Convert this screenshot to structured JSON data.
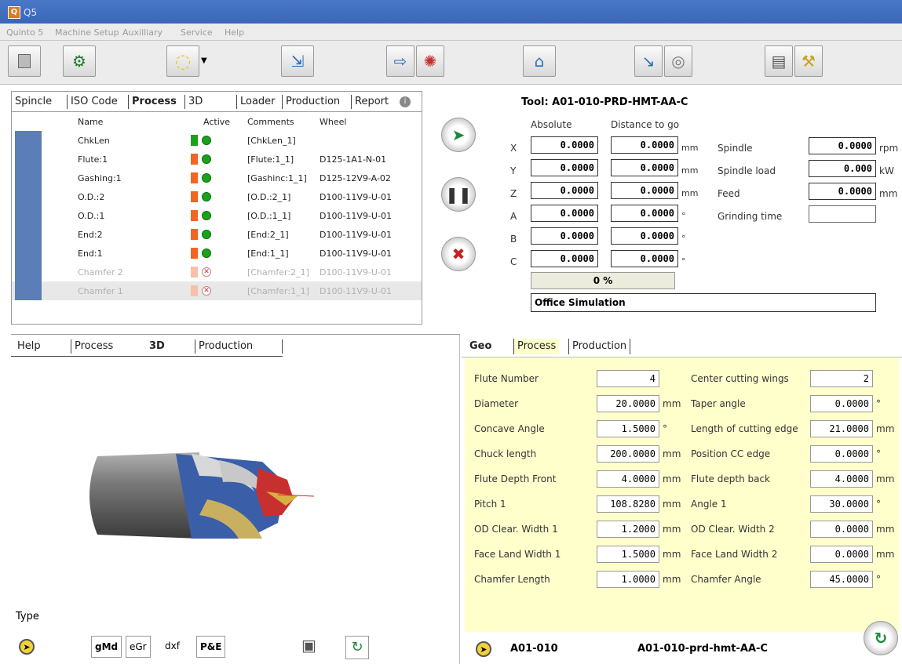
{
  "window": {
    "title": "Q5"
  },
  "menu": [
    "Quinto 5",
    "Machine Setup",
    "Auxilliary",
    "Service",
    "Help"
  ],
  "toolbar_icons": [
    "stop-icon",
    "machine-gears-icon",
    "grinding-wheel-icon",
    "dropdown-icon",
    "load-program-icon",
    "export-icon",
    "spark-icon",
    "factory-icon",
    "spindle-tool-icon",
    "wheel-disc-icon",
    "printer-icon",
    "robot-arm-icon"
  ],
  "process_tabs": [
    "Spincle",
    "ISO Code",
    "Process",
    "3D",
    "Loader",
    "Production",
    "Report"
  ],
  "process_columns": {
    "name": "Name",
    "active": "Active",
    "comments": "Comments",
    "wheel": "Wheel"
  },
  "process_rows": [
    {
      "name": "ChkLen",
      "comments": "[ChkLen_1]",
      "wheel": "",
      "bar": "#1aa31a",
      "active": true
    },
    {
      "name": "Flute:1",
      "comments": "[Flute:1_1]",
      "wheel": "D125-1A1-N-01",
      "bar": "#f26522",
      "active": true
    },
    {
      "name": "Gashing:1",
      "comments": "[Gashinc:1_1]",
      "wheel": "D125-12V9-A-02",
      "bar": "#f26522",
      "active": true
    },
    {
      "name": "O.D.:2",
      "comments": "[O.D.:2_1]",
      "wheel": "D100-11V9-U-01",
      "bar": "#f26522",
      "active": true
    },
    {
      "name": "O.D.:1",
      "comments": "[O.D.:1_1]",
      "wheel": "D100-11V9-U-01",
      "bar": "#f26522",
      "active": true
    },
    {
      "name": "End:2",
      "comments": "[End:2_1]",
      "wheel": "D100-11V9-U-01",
      "bar": "#f26522",
      "active": true
    },
    {
      "name": "End:1",
      "comments": "[End:1_1]",
      "wheel": "D100-11V9-U-01",
      "bar": "#f26522",
      "active": true
    },
    {
      "name": "Chamfer 2",
      "comments": "[Chamfer:2_1]",
      "wheel": "D100-11V9-U-01",
      "bar": "#f8c0a8",
      "active": false
    },
    {
      "name": "Chamfer 1",
      "comments": "[Chamfer:1_1]",
      "wheel": "D100-11V9-U-01",
      "bar": "#f8c0a8",
      "active": false
    }
  ],
  "tool": {
    "title": "Tool: A01-010-PRD-HMT-AA-C",
    "col_absolute": "Absolute",
    "col_distance": "Distance to go",
    "axes": [
      {
        "axis": "X",
        "abs": "0.0000",
        "dist": "0.0000",
        "unit": "mm"
      },
      {
        "axis": "Y",
        "abs": "0.0000",
        "dist": "0.0000",
        "unit": "mm"
      },
      {
        "axis": "Z",
        "abs": "0.0000",
        "dist": "0.0000",
        "unit": "mm"
      },
      {
        "axis": "A",
        "abs": "0.0000",
        "dist": "0.0000",
        "unit": "°"
      },
      {
        "axis": "B",
        "abs": "0.0000",
        "dist": "0.0000",
        "unit": "°"
      },
      {
        "axis": "C",
        "abs": "0.0000",
        "dist": "0.0000",
        "unit": "°"
      }
    ],
    "progress": "0 %",
    "progress_value": 0,
    "status": "Office Simulation",
    "spindle_label": "Spindle",
    "spindle_value": "0.0000",
    "spindle_unit": "rpm",
    "load_label": "Spindle load",
    "load_value": "0.000",
    "load_unit": "kW",
    "feed_label": "Feed",
    "feed_value": "0.0000",
    "feed_unit": "mm",
    "grind_label": "Grinding time",
    "grind_value": ""
  },
  "view_tabs": [
    "Help",
    "Process",
    "3D",
    "Production"
  ],
  "type_label": "Type",
  "type_buttons": [
    "gMd",
    "eGr",
    "dxf",
    "P&E"
  ],
  "geo_tabs": [
    "Geo",
    "Process",
    "Production"
  ],
  "geo_left": [
    {
      "label": "Flute Number",
      "value": "4",
      "unit": ""
    },
    {
      "label": "Diameter",
      "value": "20.0000",
      "unit": "mm"
    },
    {
      "label": "Concave Angle",
      "value": "1.5000",
      "unit": "°"
    },
    {
      "label": "Chuck length",
      "value": "200.0000",
      "unit": "mm"
    },
    {
      "label": "Flute Depth Front",
      "value": "4.0000",
      "unit": "mm"
    },
    {
      "label": "Pitch 1",
      "value": "108.8280",
      "unit": "mm"
    },
    {
      "label": "OD Clear. Width 1",
      "value": "1.2000",
      "unit": "mm"
    },
    {
      "label": "Face Land Width 1",
      "value": "1.5000",
      "unit": "mm"
    },
    {
      "label": "Chamfer Length",
      "value": "1.0000",
      "unit": "mm"
    }
  ],
  "geo_right": [
    {
      "label": "Center cutting wings",
      "value": "2",
      "unit": ""
    },
    {
      "label": "Taper angle",
      "value": "0.0000",
      "unit": "°"
    },
    {
      "label": "Length of cutting edge",
      "value": "21.0000",
      "unit": "mm"
    },
    {
      "label": "Position CC edge",
      "value": "0.0000",
      "unit": "°"
    },
    {
      "label": "Flute depth back",
      "value": "4.0000",
      "unit": "mm"
    },
    {
      "label": "Angle 1",
      "value": "30.0000",
      "unit": "°"
    },
    {
      "label": "OD Clear. Width 2",
      "value": "0.0000",
      "unit": "mm"
    },
    {
      "label": "Face Land Width 2",
      "value": "0.0000",
      "unit": "mm"
    },
    {
      "label": "Chamfer Angle",
      "value": "45.0000",
      "unit": "°"
    }
  ],
  "footer": {
    "code": "A01-010",
    "name": "A01-010-prd-hmt-AA-C"
  }
}
